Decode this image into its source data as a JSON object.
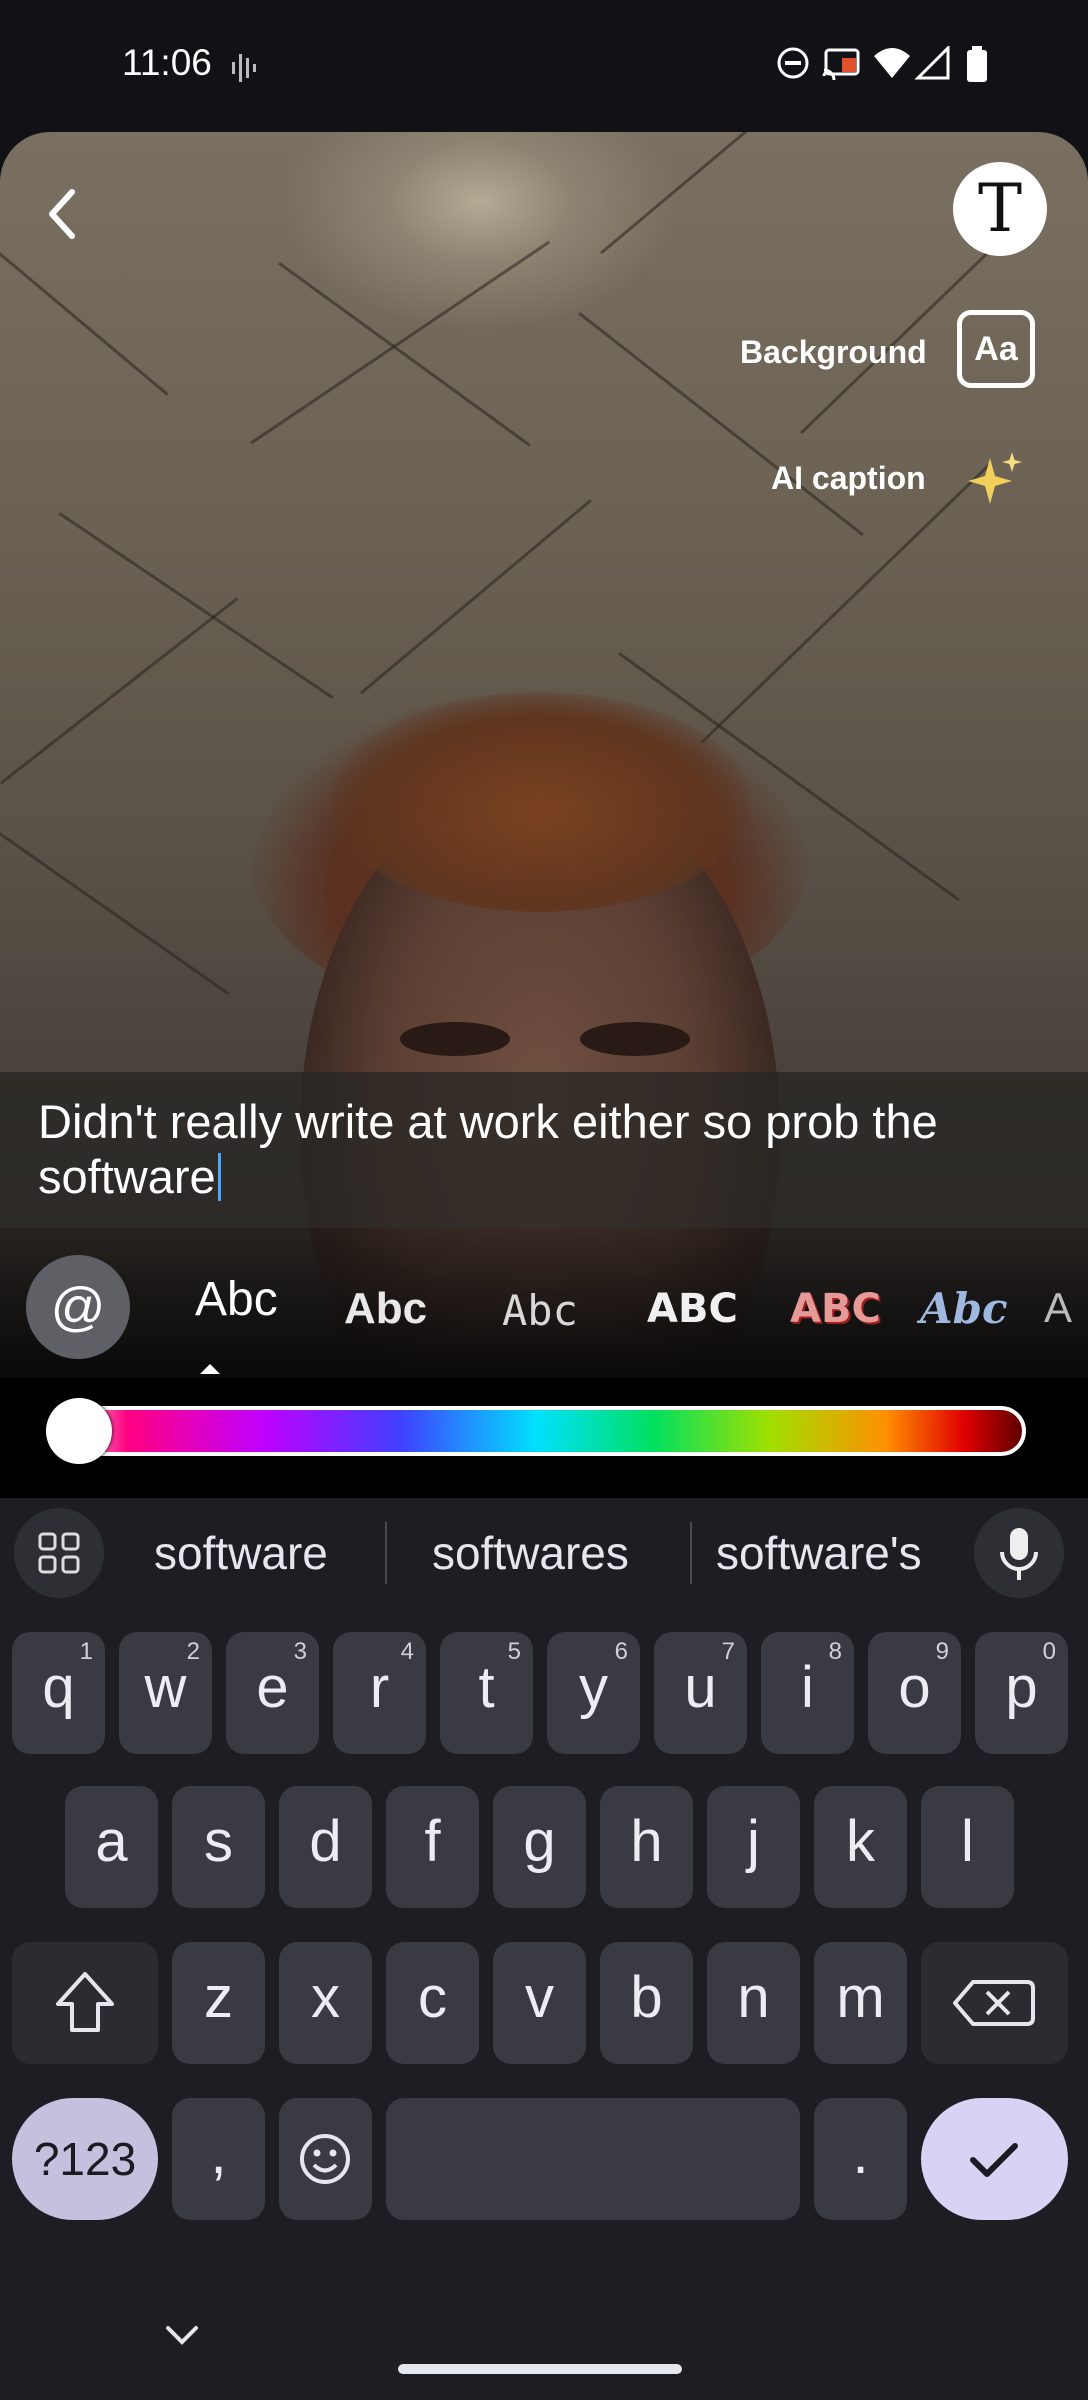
{
  "status_bar": {
    "time": "11:06"
  },
  "top_buttons": {
    "background_label": "Background",
    "background_icon_text": "Aa",
    "ai_caption_label": "AI caption",
    "text_tool_icon_text": "T"
  },
  "caption": {
    "text": "Didn't really write at work either so prob the software"
  },
  "font_styles": [
    {
      "label": "Abc"
    },
    {
      "label": "Abc"
    },
    {
      "label": "Abc"
    },
    {
      "label": "ABC"
    },
    {
      "label": "ABC"
    },
    {
      "label": "Abc"
    },
    {
      "label": "A"
    }
  ],
  "mention_button": {
    "label": "@"
  },
  "keyboard": {
    "suggestions": [
      "software",
      "softwares",
      "software's"
    ],
    "row1": [
      {
        "key": "q",
        "num": "1"
      },
      {
        "key": "w",
        "num": "2"
      },
      {
        "key": "e",
        "num": "3"
      },
      {
        "key": "r",
        "num": "4"
      },
      {
        "key": "t",
        "num": "5"
      },
      {
        "key": "y",
        "num": "6"
      },
      {
        "key": "u",
        "num": "7"
      },
      {
        "key": "i",
        "num": "8"
      },
      {
        "key": "o",
        "num": "9"
      },
      {
        "key": "p",
        "num": "0"
      }
    ],
    "row2": [
      "a",
      "s",
      "d",
      "f",
      "g",
      "h",
      "j",
      "k",
      "l"
    ],
    "row3": [
      "z",
      "x",
      "c",
      "v",
      "b",
      "n",
      "m"
    ],
    "symbols_label": "?123",
    "comma_label": ",",
    "period_label": "."
  }
}
